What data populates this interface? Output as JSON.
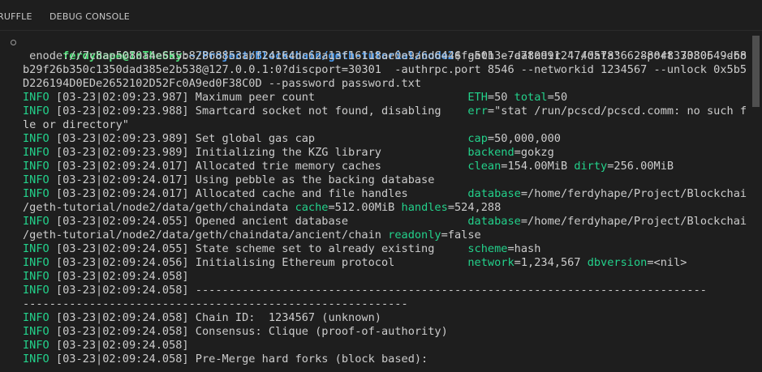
{
  "tabs": [
    {
      "label": "RUFFLE"
    },
    {
      "label": "DEBUG CONSOLE"
    }
  ],
  "prompt": {
    "user": "ferdyhape@InTheSky",
    "colon": ":",
    "path": "~/Project/Blockchain/geth-tutorial/node2",
    "dollar": "$",
    "command_lines": [
      " geth --datadir \"./data\"  --port 30306 --bootnodes",
      " enode://7c8ae5080a4e655b82868853abf24164dc62a13f16118ae0e9a6d6446fa5013e7e7809912474057836628804837380549d680",
      "b29f26b350c1350dad385e2b538@127.0.0.1:0?discport=30301  -authrpc.port 8546 --networkid 1234567 --unlock 0x5b5c",
      "D226194D0EDe2652102D52Fc0A9ed0F38C0D --password password.txt"
    ]
  },
  "logs": [
    [
      {
        "t": "INFO",
        "c": "info"
      },
      {
        "t": " [03-23|02:09:23.987] Maximum peer count                       "
      },
      {
        "t": "ETH",
        "c": "key"
      },
      {
        "t": "=50 "
      },
      {
        "t": "total",
        "c": "key"
      },
      {
        "t": "=50"
      }
    ],
    [
      {
        "t": "INFO",
        "c": "info"
      },
      {
        "t": " [03-23|02:09:23.988] Smartcard socket not found, disabling    "
      },
      {
        "t": "err",
        "c": "key"
      },
      {
        "t": "=\"stat /run/pcscd/pcscd.comm: no such fi"
      }
    ],
    [
      {
        "t": "le or directory\""
      }
    ],
    [
      {
        "t": "INFO",
        "c": "info"
      },
      {
        "t": " [03-23|02:09:23.989] Set global gas cap                       "
      },
      {
        "t": "cap",
        "c": "key"
      },
      {
        "t": "=50,000,000"
      }
    ],
    [
      {
        "t": "INFO",
        "c": "info"
      },
      {
        "t": " [03-23|02:09:23.989] Initializing the KZG library             "
      },
      {
        "t": "backend",
        "c": "key"
      },
      {
        "t": "=gokzg"
      }
    ],
    [
      {
        "t": "INFO",
        "c": "info"
      },
      {
        "t": " [03-23|02:09:24.017] Allocated trie memory caches             "
      },
      {
        "t": "clean",
        "c": "key"
      },
      {
        "t": "=154.00MiB "
      },
      {
        "t": "dirty",
        "c": "key"
      },
      {
        "t": "=256.00MiB"
      }
    ],
    [
      {
        "t": "INFO",
        "c": "info"
      },
      {
        "t": " [03-23|02:09:24.017] Using pebble as the backing database"
      }
    ],
    [
      {
        "t": "INFO",
        "c": "info"
      },
      {
        "t": " [03-23|02:09:24.017] Allocated cache and file handles         "
      },
      {
        "t": "database",
        "c": "key"
      },
      {
        "t": "=/home/ferdyhape/Project/Blockchain"
      }
    ],
    [
      {
        "t": "/geth-tutorial/node2/data/geth/chaindata "
      },
      {
        "t": "cache",
        "c": "key"
      },
      {
        "t": "=512.00MiB "
      },
      {
        "t": "handles",
        "c": "key"
      },
      {
        "t": "=524,288"
      }
    ],
    [
      {
        "t": "INFO",
        "c": "info"
      },
      {
        "t": " [03-23|02:09:24.055] Opened ancient database                  "
      },
      {
        "t": "database",
        "c": "key"
      },
      {
        "t": "=/home/ferdyhape/Project/Blockchain"
      }
    ],
    [
      {
        "t": "/geth-tutorial/node2/data/geth/chaindata/ancient/chain "
      },
      {
        "t": "readonly",
        "c": "key"
      },
      {
        "t": "=false"
      }
    ],
    [
      {
        "t": "INFO",
        "c": "info"
      },
      {
        "t": " [03-23|02:09:24.055] State scheme set to already existing     "
      },
      {
        "t": "scheme",
        "c": "key"
      },
      {
        "t": "=hash"
      }
    ],
    [
      {
        "t": "INFO",
        "c": "info"
      },
      {
        "t": " [03-23|02:09:24.056] Initialising Ethereum protocol           "
      },
      {
        "t": "network",
        "c": "key"
      },
      {
        "t": "=1,234,567 "
      },
      {
        "t": "dbversion",
        "c": "key"
      },
      {
        "t": "=<nil>"
      }
    ],
    [
      {
        "t": "INFO",
        "c": "info"
      },
      {
        "t": " [03-23|02:09:24.058]"
      }
    ],
    [
      {
        "t": "INFO",
        "c": "info"
      },
      {
        "t": " [03-23|02:09:24.058] -----------------------------------------------------------------------------"
      }
    ],
    [
      {
        "t": "----------------------------------------------------------"
      }
    ],
    [
      {
        "t": "INFO",
        "c": "info"
      },
      {
        "t": " [03-23|02:09:24.058] Chain ID:  1234567 (unknown)"
      }
    ],
    [
      {
        "t": "INFO",
        "c": "info"
      },
      {
        "t": " [03-23|02:09:24.058] Consensus: Clique (proof-of-authority)"
      }
    ],
    [
      {
        "t": "INFO",
        "c": "info"
      },
      {
        "t": " [03-23|02:09:24.058]"
      }
    ],
    [
      {
        "t": "INFO",
        "c": "info"
      },
      {
        "t": " [03-23|02:09:24.058] Pre-Merge hard forks (block based):"
      }
    ]
  ],
  "colors": {
    "background": "#1e1e1e",
    "info": "#23d18b",
    "user": "#4fe07a",
    "path": "#4d9cf0",
    "text": "#cccccc"
  }
}
